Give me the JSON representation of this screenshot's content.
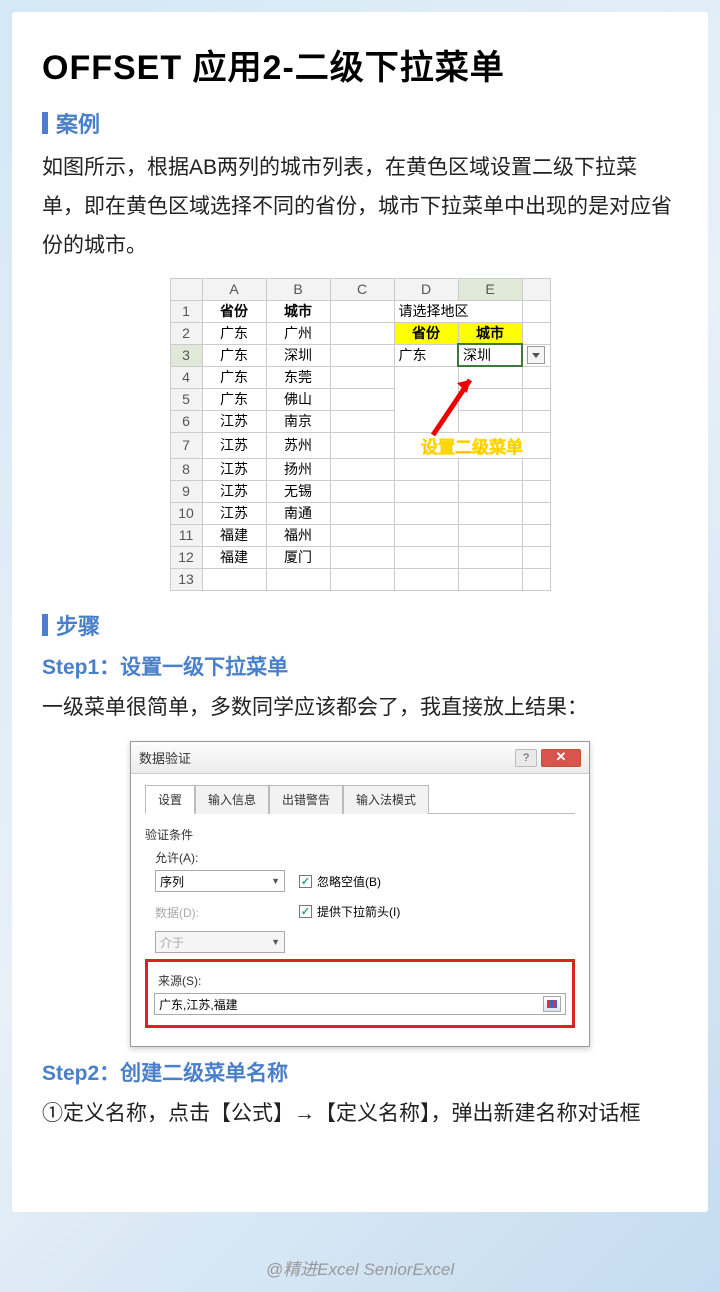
{
  "title": "OFFSET 应用2-二级下拉菜单",
  "sections": {
    "case": "案例",
    "steps": "步骤"
  },
  "case_text": "如图所示，根据AB两列的城市列表，在黄色区域设置二级下拉菜单，即在黄色区域选择不同的省份，城市下拉菜单中出现的是对应省份的城市。",
  "sheet": {
    "cols": [
      "A",
      "B",
      "C",
      "D",
      "E"
    ],
    "header_row": {
      "A": "省份",
      "B": "城市",
      "D": "请选择地区"
    },
    "yellow_row": {
      "D": "省份",
      "E": "城市"
    },
    "sel_row": {
      "D": "广东",
      "E": "深圳"
    },
    "data": [
      [
        "广东",
        "广州"
      ],
      [
        "广东",
        "深圳"
      ],
      [
        "广东",
        "东莞"
      ],
      [
        "广东",
        "佛山"
      ],
      [
        "江苏",
        "南京"
      ],
      [
        "江苏",
        "苏州"
      ],
      [
        "江苏",
        "扬州"
      ],
      [
        "江苏",
        "无锡"
      ],
      [
        "江苏",
        "南通"
      ],
      [
        "福建",
        "福州"
      ],
      [
        "福建",
        "厦门"
      ]
    ],
    "annotation": "设置二级菜单"
  },
  "step1": {
    "title": "Step1：设置一级下拉菜单",
    "text": "一级菜单很简单，多数同学应该都会了，我直接放上结果："
  },
  "dialog": {
    "title": "数据验证",
    "tabs": [
      "设置",
      "输入信息",
      "出错警告",
      "输入法模式"
    ],
    "group": "验证条件",
    "allow_label": "允许(A):",
    "allow_value": "序列",
    "ignore_blank": "忽略空值(B)",
    "dropdown_arrow": "提供下拉箭头(I)",
    "data_label": "数据(D):",
    "data_value": "介于",
    "source_label": "来源(S):",
    "source_value": "广东,江苏,福建"
  },
  "step2": {
    "title": "Step2：创建二级菜单名称",
    "text": "①定义名称，点击【公式】→【定义名称】，弹出新建名称对话框"
  },
  "footer": "@精进Excel    SeniorExcel"
}
